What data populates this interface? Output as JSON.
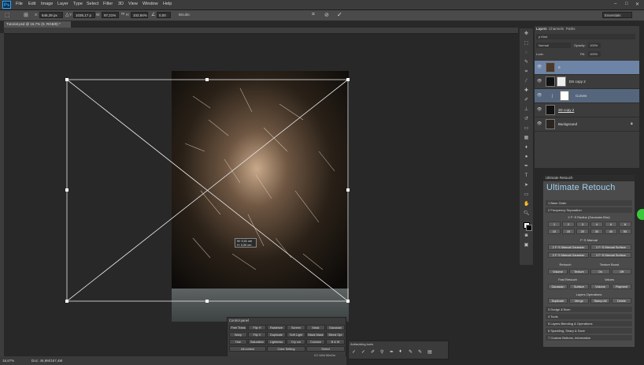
{
  "app": {
    "logo": "Ps"
  },
  "menu": [
    "File",
    "Edit",
    "Image",
    "Layer",
    "Type",
    "Select",
    "Filter",
    "3D",
    "View",
    "Window",
    "Help"
  ],
  "options": {
    "x": "646,39 px",
    "y": "1035,17 p",
    "w_label": "W:",
    "w": "97,21%",
    "h_label": "H:",
    "h": "102,94%",
    "angle": "0,00",
    "interp": "Bicubic",
    "workspace": "Essentials"
  },
  "doc_tab": "Tutorial.psd @ 16,7% (0, RGB/8) *",
  "transform_readout": {
    "w": "W: 0,01 cm",
    "h": "H: 0,00 cm"
  },
  "layers_panel": {
    "tabs": [
      "Layers",
      "Channels",
      "Paths"
    ],
    "blend": "Normal",
    "opacity_label": "Opacity:",
    "opacity": "100%",
    "lock_label": "Lock:",
    "fill_label": "Fill:",
    "fill": "100%",
    "layers": [
      {
        "name": "0"
      },
      {
        "name": "DS copy 2"
      },
      {
        "name": "Curves"
      },
      {
        "name": "3D copy 2"
      },
      {
        "name": "Background"
      }
    ]
  },
  "ultimate_retouch": {
    "title": "Ultimate Retouch",
    "logo": "Ultimate Retouch",
    "sec1": "1 Base Grain",
    "sec2": "2 Frequency Separation",
    "fs_label": "2 F~S Radius (Gaussian Blur)",
    "radius": [
      "1",
      "2",
      "3",
      "4",
      "6",
      "8",
      "10",
      "15",
      "20",
      "30",
      "40",
      "50"
    ],
    "manual_label": "F~S Manual",
    "manual": [
      "2 F~S Manual Gaussian",
      "2 F~S Manual Surface",
      "3 F~S Manual Gaussian",
      "3 F~S Manual Surface"
    ],
    "retouch_label": "Retouch",
    "texture_label": "Texture Boost",
    "retouch_btns": [
      "Volume",
      "Texture",
      "On",
      "Off"
    ],
    "fast_label": "Fast Retouch",
    "values_label": "Values",
    "fast_btns": [
      "Gaussian",
      "Surface",
      "Volume",
      "Payment"
    ],
    "layers_ops": "Layers Operations",
    "layer_btns": [
      "Duplicate",
      "Merge",
      "Stamp All",
      "Delete"
    ],
    "sections": [
      "3 Dodge & Burn",
      "4 Tools",
      "5 Layers Blending & Operations",
      "6 Sparkling, Sharp & Save",
      "7 Custom Buttons, Information"
    ]
  },
  "control_panel": {
    "title": "Control panel",
    "rows": [
      [
        "Free Trans",
        "Flip H",
        "Rasterize",
        "Screen",
        "Mask",
        "Gaussian"
      ],
      [
        "Warp",
        "Flip V",
        "Duplicate",
        "Soft Light",
        "Black Mask",
        "Blend Opt"
      ],
      [
        "Hue",
        "Saturation",
        "Lightness",
        "Cry cor",
        "Colorize",
        "B & W"
      ]
    ],
    "bottom": [
      "All control",
      "Color Setting",
      "Select"
    ],
    "credit": "(C) Wild WinDer"
  },
  "dodge_panel": {
    "title": "Antiaviding tools"
  },
  "status": {
    "zoom": "16,67%",
    "doc": "Doc: 46,9M/167,4M"
  }
}
